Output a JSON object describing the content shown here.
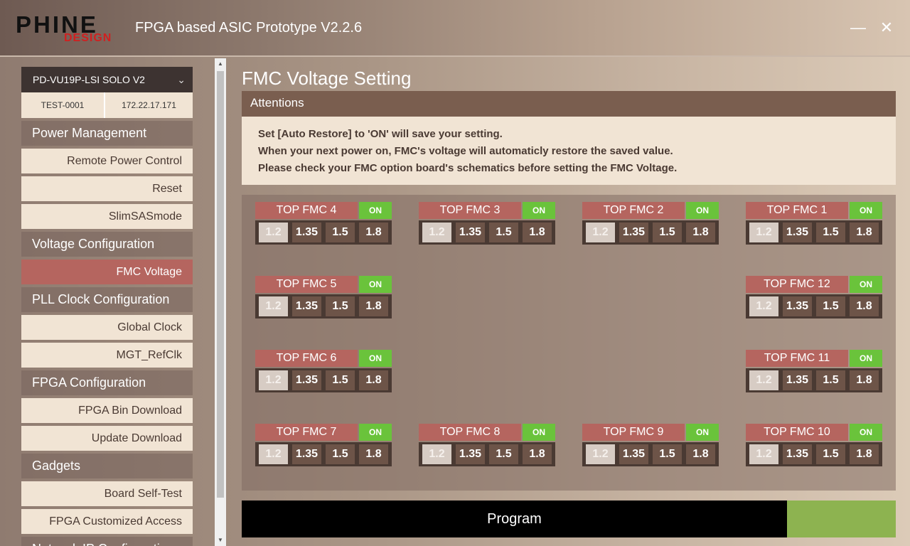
{
  "header": {
    "logo_main": "PHINE",
    "logo_sub": "DESIGN",
    "title": "FPGA based ASIC Prototype V2.2.6",
    "minimize_icon": "minimize-icon",
    "close_icon": "close-icon"
  },
  "sidebar": {
    "device": "PD-VU19P-LSI SOLO V2",
    "device_id": "TEST-0001",
    "device_ip": "172.22.17.171",
    "sections": [
      {
        "title": "Power Management",
        "items": [
          "Remote Power Control",
          "Reset",
          "SlimSASmode"
        ]
      },
      {
        "title": "Voltage Configuration",
        "items": [
          "FMC Voltage"
        ]
      },
      {
        "title": "PLL Clock Configuration",
        "items": [
          "Global Clock",
          "MGT_RefClk"
        ]
      },
      {
        "title": "FPGA Configuration",
        "items": [
          "FPGA Bin Download",
          "Update Download"
        ]
      },
      {
        "title": "Gadgets",
        "items": [
          "Board Self-Test",
          "FPGA Customized Access"
        ]
      },
      {
        "title": "Network IP Configuration",
        "items": []
      }
    ],
    "active_item": "FMC Voltage"
  },
  "main": {
    "title": "FMC Voltage Setting",
    "attention": {
      "heading": "Attentions",
      "lines": [
        "Set [Auto Restore] to 'ON' will save your setting.",
        "When your next power on, FMC's voltage will automaticly restore the saved value.",
        "Please check your FMC option board's schematics before setting the FMC Voltage."
      ]
    },
    "voltage_options": [
      "1.2",
      "1.35",
      "1.5",
      "1.8"
    ],
    "fmcs": [
      {
        "label": "TOP FMC 4",
        "auto_restore": "ON",
        "selected": "1.2"
      },
      {
        "label": "TOP FMC 3",
        "auto_restore": "ON",
        "selected": "1.2"
      },
      {
        "label": "TOP FMC 2",
        "auto_restore": "ON",
        "selected": "1.2"
      },
      {
        "label": "TOP FMC 1",
        "auto_restore": "ON",
        "selected": "1.2"
      },
      {
        "label": "TOP FMC 5",
        "auto_restore": "ON",
        "selected": "1.2"
      },
      {
        "label": "TOP FMC 12",
        "auto_restore": "ON",
        "selected": "1.2"
      },
      {
        "label": "TOP FMC 6",
        "auto_restore": "ON",
        "selected": "1.2"
      },
      {
        "label": "TOP FMC 11",
        "auto_restore": "ON",
        "selected": "1.2"
      },
      {
        "label": "TOP FMC 7",
        "auto_restore": "ON",
        "selected": "1.2"
      },
      {
        "label": "TOP FMC 8",
        "auto_restore": "ON",
        "selected": "1.2"
      },
      {
        "label": "TOP FMC 9",
        "auto_restore": "ON",
        "selected": "1.2"
      },
      {
        "label": "TOP FMC 10",
        "auto_restore": "ON",
        "selected": "1.2"
      }
    ],
    "program_label": "Program"
  },
  "colors": {
    "accent": "#b5655f",
    "on_green": "#6ac33b",
    "progress_green": "#8db350",
    "attention_head": "#7a5e4f"
  }
}
